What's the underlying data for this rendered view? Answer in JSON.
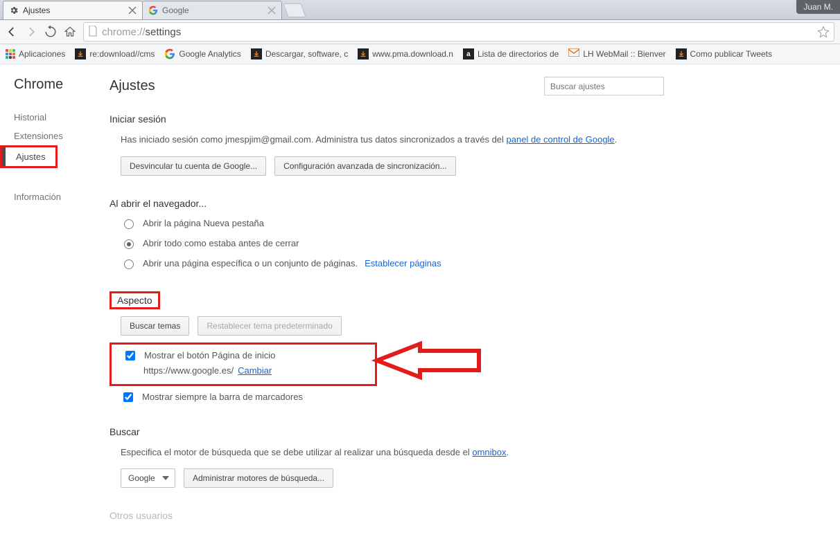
{
  "window": {
    "user_badge": "Juan M."
  },
  "tabs": [
    {
      "title": "Ajustes",
      "active": true
    },
    {
      "title": "Google",
      "active": false
    }
  ],
  "url": {
    "scheme": "chrome://",
    "path": "settings"
  },
  "bookmarks": {
    "apps_label": "Aplicaciones",
    "items": [
      {
        "label": "re:download//cms",
        "icon": "dn"
      },
      {
        "label": "Google Analytics",
        "icon": "g"
      },
      {
        "label": "Descargar, software, c",
        "icon": "dn"
      },
      {
        "label": "www.pma.download.n",
        "icon": "dn"
      },
      {
        "label": "Lista de directorios de",
        "icon": "a"
      },
      {
        "label": "LH WebMail :: Bienver",
        "icon": "mail"
      },
      {
        "label": "Como publicar Tweets",
        "icon": "dn"
      }
    ]
  },
  "sidebar": {
    "brand": "Chrome",
    "items": [
      "Historial",
      "Extensiones",
      "Ajustes",
      "Información"
    ],
    "selected_index": 2
  },
  "settings": {
    "page_title": "Ajustes",
    "search_placeholder": "Buscar ajustes",
    "signin": {
      "title": "Iniciar sesión",
      "text_prefix": "Has iniciado sesión como jmespjim@gmail.com. Administra tus datos sincronizados a través del ",
      "panel_link": "panel de control de Google",
      "btn_unlink": "Desvincular tu cuenta de Google...",
      "btn_sync": "Configuración avanzada de sincronización..."
    },
    "startup": {
      "title": "Al abrir el navegador...",
      "opt_newtab": "Abrir la página Nueva pestaña",
      "opt_restore": "Abrir todo como estaba antes de cerrar",
      "opt_specific": "Abrir una página específica o un conjunto de páginas.",
      "set_pages_link": "Establecer páginas"
    },
    "appearance": {
      "title": "Aspecto",
      "btn_themes": "Buscar temas",
      "btn_reset_theme": "Restablecer tema predeterminado",
      "chk_home": "Mostrar el botón Página de inicio",
      "home_url": "https://www.google.es/",
      "change_link": "Cambiar",
      "chk_bookmarks": "Mostrar siempre la barra de marcadores"
    },
    "search": {
      "title": "Buscar",
      "desc_prefix": "Especifica el motor de búsqueda que se debe utilizar al realizar una búsqueda desde el ",
      "omnibox_link": "omnibox",
      "engine": "Google",
      "btn_manage": "Administrar motores de búsqueda..."
    },
    "other_users_title": "Otros usuarios"
  }
}
